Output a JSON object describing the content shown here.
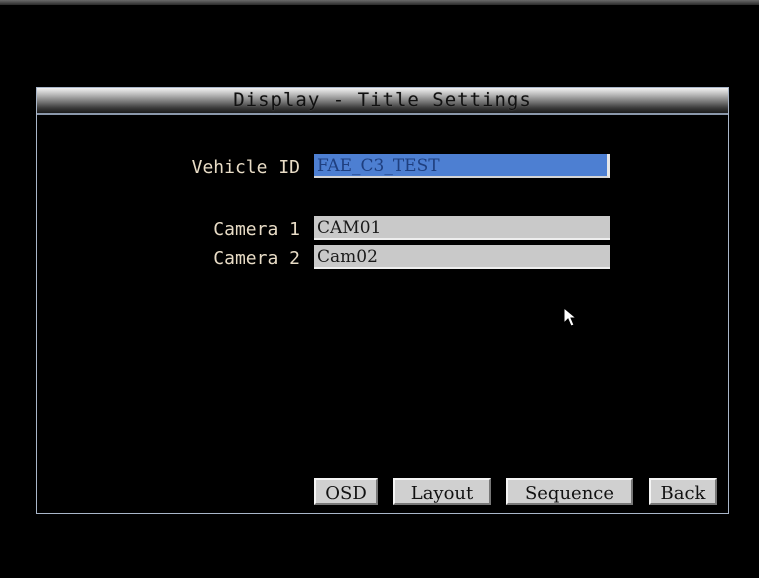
{
  "window": {
    "title_left": "Display",
    "title_sep": "-",
    "title_right": "Title Settings"
  },
  "form": {
    "vehicle_id_label": "Vehicle ID",
    "vehicle_id_value": "FAE_C3_TEST",
    "camera1_label": "Camera 1",
    "camera1_value": "CAM01",
    "camera2_label": "Camera 2",
    "camera2_value": "Cam02"
  },
  "buttons": {
    "osd": "OSD",
    "layout": "Layout",
    "sequence": "Sequence",
    "back": "Back"
  },
  "icons": {
    "pointer": "mouse-pointer-icon"
  }
}
